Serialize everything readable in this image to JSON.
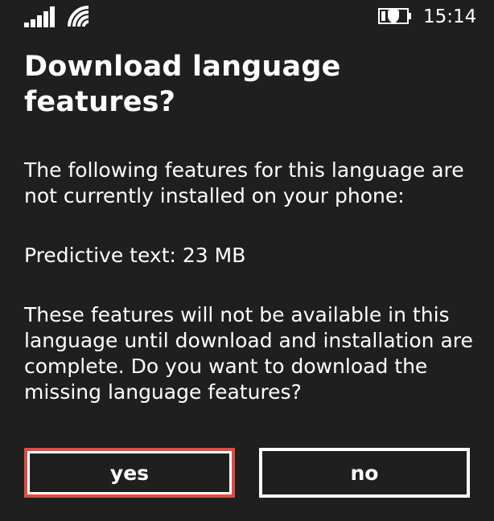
{
  "status_bar": {
    "time": "15:14",
    "icons": {
      "signal": "signal-strength-icon",
      "wifi": "wifi-icon",
      "battery": "battery-saver-icon"
    }
  },
  "dialog": {
    "title": "Download language features?",
    "intro": "The following features for this language are not currently installed on your phone:",
    "features": [
      "Predictive text: 23 MB"
    ],
    "info": "These features will not be available in this language until download and installation are complete. Do you want to download the missing language features?"
  },
  "buttons": {
    "yes_label": "yes",
    "no_label": "no"
  },
  "colors": {
    "background": "#1f1f1f",
    "text": "#ffffff",
    "highlight_border": "#e04b43"
  }
}
